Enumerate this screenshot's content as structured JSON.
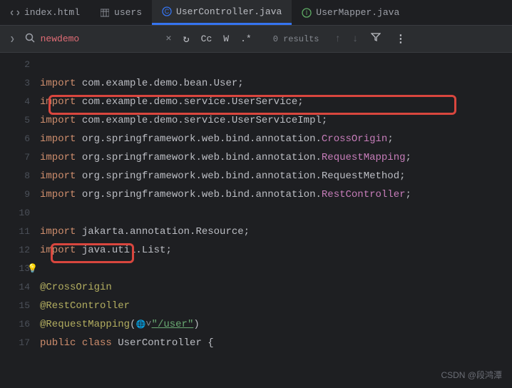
{
  "tabs": [
    {
      "label": "index.html"
    },
    {
      "label": "users"
    },
    {
      "label": "UserController.java",
      "active": true
    },
    {
      "label": "UserMapper.java"
    }
  ],
  "search": {
    "value": "newdemo",
    "results": "0 results",
    "cc": "Cc",
    "w": "W",
    "regex": ".*"
  },
  "lines": {
    "l2": "2",
    "l3": "3",
    "l4": "4",
    "l5": "5",
    "l6": "6",
    "l7": "7",
    "l8": "8",
    "l9": "9",
    "l10": "10",
    "l11": "11",
    "l12": "12",
    "l13": "13",
    "l14": "14",
    "l15": "15",
    "l16": "16",
    "l17": "17"
  },
  "code": {
    "kw_import": "import",
    "kw_public": "public",
    "kw_class": "class",
    "p3": " com.example.demo.bean.User",
    "p4": " com.example.demo.service.UserService",
    "p5": " com.example.demo.service.UserServiceImpl",
    "p6a": " org.springframework.web.bind.annotation.",
    "p6b": "CrossOrigin",
    "p7a": " org.springframework.web.bind.annotation.",
    "p7b": "RequestMapping",
    "p8": " org.springframework.web.bind.annotation.RequestMethod",
    "p9a": " org.springframework.web.bind.annotation.",
    "p9b": "RestController",
    "p11": " jakarta.annotation.Resource",
    "p12": " java.util.List",
    "a14": "@CrossOrigin",
    "a15": "@RestController",
    "a16": "@RequestMapping",
    "a16paren_open": "(",
    "a16str": "\"/user\"",
    "a16paren_close": ")",
    "c17": " UserController {",
    "semi": ";"
  },
  "watermark": "CSDN @段鸿潭"
}
